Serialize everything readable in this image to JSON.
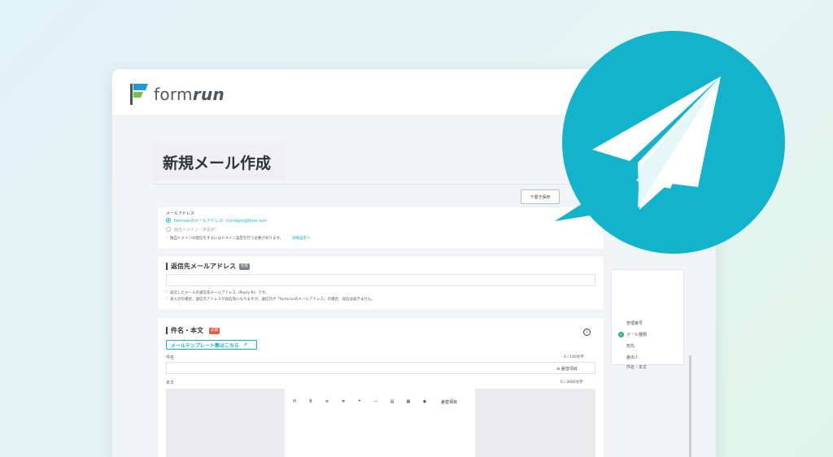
{
  "app": {
    "logo_text_light": "form",
    "logo_text_bold": "run",
    "logo_colors": [
      "#1e9bd7",
      "#7ac143"
    ]
  },
  "page": {
    "title": "新規メール作成",
    "save_draft_label": "下書き保存"
  },
  "sender": {
    "label": "メールアドレス",
    "option_default": "formrunのメールアドレス（no-reply@form.run）",
    "option_custom": "独自ドメイン（未設定）",
    "note": "独自ドメインの配信をするにはドメイン設定を行う必要があります。",
    "note_link": "詳細設定へ"
  },
  "reply_to": {
    "section_title": "返信先メールアドレス",
    "badge": "任意",
    "note_1": "返信したメールの送信先メールアドレス（Reply-To）です。",
    "note_2": "未入力の場合、送信元アドレスが返信先になりますが、送信元が「formrunのメールアドレス」の場合、返信は届きません。"
  },
  "composer": {
    "section_title": "件名・本文",
    "badge": "必須",
    "template_button": "メールテンプレート集はこちら",
    "subject_label": "件名",
    "subject_counter": "0 / 100文字",
    "insert_field_label": "差替項目",
    "body_label": "本文",
    "body_counter": "0 / 3000文字",
    "toolbar": [
      "H",
      "B",
      "≡",
      "≣",
      "❝",
      "—",
      "▤",
      "▦",
      "◉",
      "差替項目"
    ]
  },
  "sidebar": {
    "items": [
      {
        "label": "管理番号",
        "checked": false
      },
      {
        "label": "メール種類",
        "checked": true
      },
      {
        "label": "宛先",
        "checked": false
      },
      {
        "label": "差出人",
        "checked": false
      },
      {
        "label": "件名・本文",
        "checked": false
      }
    ]
  },
  "decoration": {
    "bubble_color": "#13b3cb",
    "icon": "paper-plane-icon"
  }
}
